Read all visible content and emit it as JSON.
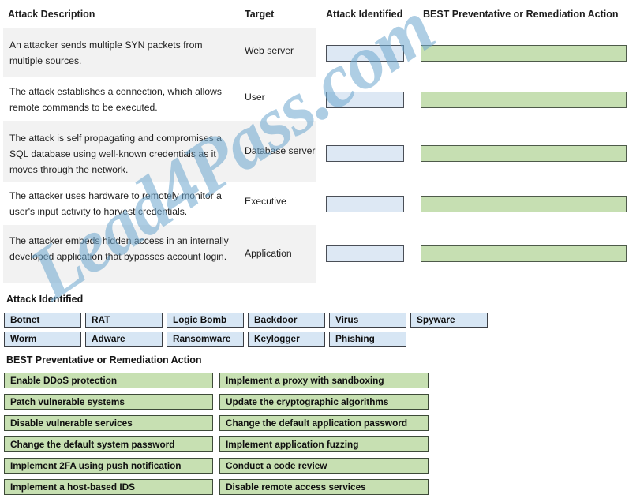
{
  "watermark": {
    "text": "Lead4Pass.com"
  },
  "table": {
    "headers": {
      "description": "Attack Description",
      "target": "Target",
      "attack_identified": "Attack Identified",
      "best_action": "BEST Preventative or Remediation Action"
    },
    "rows": [
      {
        "description": "An attacker sends multiple SYN packets from multiple sources.",
        "target": "Web server",
        "attack_identified_value": "",
        "best_action_value": ""
      },
      {
        "description": "The attack establishes a connection, which allows remote commands to be executed.",
        "target": "User",
        "attack_identified_value": "",
        "best_action_value": ""
      },
      {
        "description": "The attack is self propagating and compromises a SQL database using well-known credentials as it moves through the network.",
        "target": "Database server",
        "attack_identified_value": "",
        "best_action_value": ""
      },
      {
        "description": "The attacker uses hardware to remotely monitor a user's input activity to harvest credentials.",
        "target": "Executive",
        "attack_identified_value": "",
        "best_action_value": ""
      },
      {
        "description": "The attacker embeds hidden access in an internally developed application that bypasses account login.",
        "target": "Application",
        "attack_identified_value": "",
        "best_action_value": ""
      }
    ]
  },
  "attack_bank": {
    "title": "Attack Identified",
    "row1": [
      "Botnet",
      "RAT",
      "Logic Bomb",
      "Backdoor",
      "Virus",
      "Spyware"
    ],
    "row2": [
      "Worm",
      "Adware",
      "Ransomware",
      "Keylogger",
      "Phishing"
    ]
  },
  "action_bank": {
    "title": "BEST Preventative or Remediation Action",
    "left": [
      "Enable DDoS protection",
      "Patch vulnerable systems",
      "Disable vulnerable services",
      "Change the default system password",
      "Implement 2FA using push notification",
      "Implement a host-based IDS"
    ],
    "right": [
      "Implement a proxy with sandboxing",
      "Update the cryptographic algorithms",
      "Change the default application password",
      "Implement application fuzzing",
      "Conduct a code review",
      "Disable remote access services"
    ]
  },
  "colors": {
    "attack_chip": "#d7e6f4",
    "action_chip": "#c7e0b2",
    "row_shade": "#f2f2f2",
    "watermark": "#6fa8cf"
  }
}
